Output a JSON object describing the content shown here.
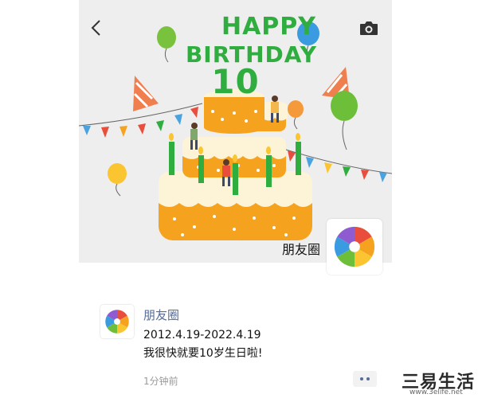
{
  "cover": {
    "headline_top": "HAPPY",
    "headline_mid": "BIRTHDAY",
    "headline_number": "10",
    "profile_name": "朋友圈"
  },
  "toolbar": {
    "back_icon": "chevron-left-icon",
    "camera_icon": "camera-icon"
  },
  "post": {
    "author": "朋友圈",
    "line1": "2012.4.19-2022.4.19",
    "line2": "我很快就要10岁生日啦!",
    "time": "1分钟前",
    "more_icon": "more-dots-icon"
  },
  "watermark": {
    "text": "三易生活",
    "url": "www.3elife.net"
  },
  "colors": {
    "headline_green": "#2fae3f",
    "link_blue": "#576b95",
    "cake_orange": "#f5a21f",
    "cake_yellow": "#fbc531"
  }
}
